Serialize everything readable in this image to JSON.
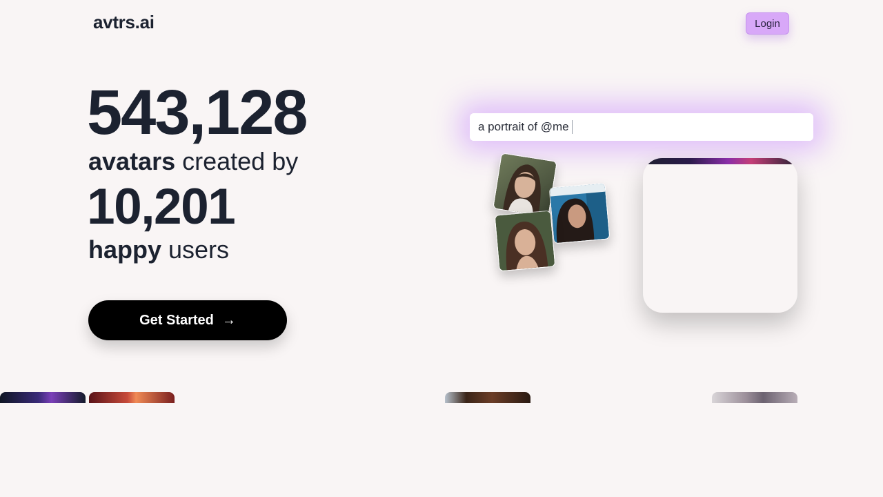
{
  "brand": {
    "logo_text": "avtrs.ai"
  },
  "header": {
    "login_label": "Login"
  },
  "hero": {
    "avatars_count": "543,128",
    "avatars_word": "avatars",
    "avatars_suffix": " created by",
    "users_count": "10,201",
    "users_word": "happy",
    "users_suffix": " users",
    "cta_label": "Get Started",
    "cta_arrow": "→"
  },
  "demo": {
    "prompt_value": "a portrait of @me",
    "input_photos": [
      "portrait-photo",
      "portrait-photo",
      "portrait-photo"
    ]
  },
  "colors": {
    "background": "#f9f5f5",
    "text": "#1c2230",
    "login_bg": "#d8a8f8",
    "cta_bg": "#000000",
    "glow": "#be78ff"
  }
}
